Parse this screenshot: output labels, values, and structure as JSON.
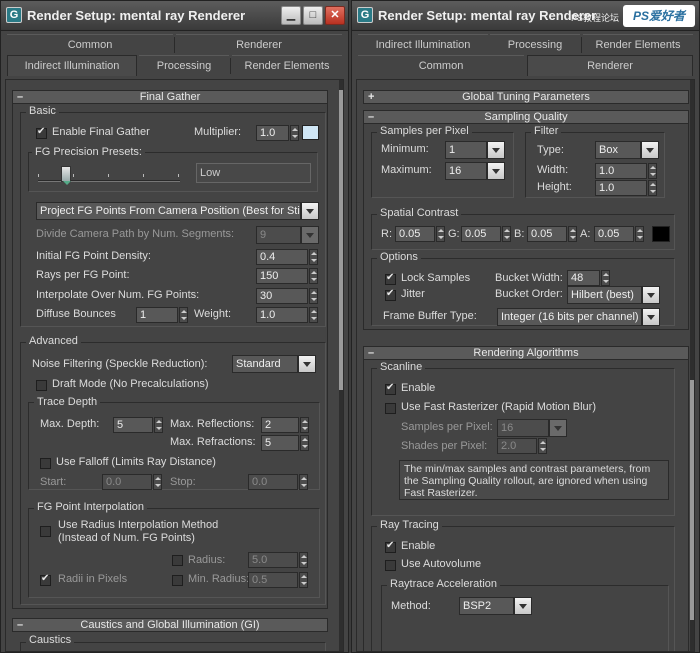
{
  "left": {
    "title": "Render Setup: mental ray Renderer",
    "icon": "G",
    "tabs_row1": [
      "Common",
      "Renderer"
    ],
    "tabs_row2": [
      "Indirect Illumination",
      "Processing",
      "Render Elements"
    ],
    "final_gather": {
      "header": "Final Gather",
      "basic": {
        "label": "Basic",
        "enable_label": "Enable Final Gather",
        "multiplier_label": "Multiplier:",
        "multiplier_value": "1.0",
        "presets_label": "FG Precision Presets:",
        "presets_value": "Low",
        "presets_level": 0.2,
        "project_mode": "Project FG Points From Camera Position (Best for Stills)",
        "divide_label": "Divide Camera Path by Num. Segments:",
        "divide_value": "9",
        "density_label": "Initial FG Point Density:",
        "density_value": "0.4",
        "rays_label": "Rays per FG Point:",
        "rays_value": "150",
        "interp_label": "Interpolate Over Num. FG Points:",
        "interp_value": "30",
        "bounces_label": "Diffuse Bounces",
        "bounces_value": "1",
        "weight_label": "Weight:",
        "weight_value": "1.0"
      },
      "advanced": {
        "label": "Advanced",
        "noise_label": "Noise Filtering (Speckle Reduction):",
        "noise_value": "Standard",
        "draft_label": "Draft Mode (No Precalculations)",
        "trace_depth": {
          "label": "Trace Depth",
          "max_depth_label": "Max. Depth:",
          "max_depth_value": "5",
          "max_refl_label": "Max. Reflections:",
          "max_refl_value": "2",
          "max_refr_label": "Max. Refractions:",
          "max_refr_value": "5",
          "falloff_label": "Use Falloff (Limits Ray Distance)",
          "start_label": "Start:",
          "start_value": "0.0",
          "stop_label": "Stop:",
          "stop_value": "0.0"
        },
        "fg_interp": {
          "label": "FG Point Interpolation",
          "radius_method_line1": "Use Radius Interpolation Method",
          "radius_method_line2": "(Instead of Num. FG Points)",
          "radius_label": "Radius:",
          "radius_value": "5.0",
          "radii_pixels_label": "Radii in Pixels",
          "min_radius_label": "Min. Radius:",
          "min_radius_value": "0.5"
        }
      }
    },
    "caustics": {
      "header": "Caustics and Global Illumination (GI)",
      "sub_label": "Caustics"
    }
  },
  "right": {
    "title": "Render Setup: mental ray Renderer",
    "icon": "G",
    "watermark_text": "PS教程论坛",
    "watermark_logo": "PS爱好者",
    "tabs_row1": [
      "Indirect Illumination",
      "Processing",
      "Render Elements"
    ],
    "tabs_row2": [
      "Common",
      "Renderer"
    ],
    "global_tuning": "Global Tuning Parameters",
    "sampling": {
      "header": "Sampling Quality",
      "samples_label": "Samples per Pixel",
      "min_label": "Minimum:",
      "min_value": "1",
      "max_label": "Maximum:",
      "max_value": "16",
      "filter_label": "Filter",
      "type_label": "Type:",
      "type_value": "Box",
      "width_label": "Width:",
      "width_value": "1.0",
      "height_label": "Height:",
      "height_value": "1.0",
      "contrast_label": "Spatial Contrast",
      "r_label": "R:",
      "r_value": "0.05",
      "g_label": "G:",
      "g_value": "0.05",
      "b_label": "B:",
      "b_value": "0.05",
      "a_label": "A:",
      "a_value": "0.05",
      "options_label": "Options",
      "lock_label": "Lock Samples",
      "jitter_label": "Jitter",
      "bucket_width_label": "Bucket Width:",
      "bucket_width_value": "48",
      "bucket_order_label": "Bucket Order:",
      "bucket_order_value": "Hilbert (best)",
      "fb_label": "Frame Buffer Type:",
      "fb_value": "Integer (16 bits per channel)"
    },
    "rendering": {
      "header": "Rendering Algorithms",
      "scanline_label": "Scanline",
      "enable_label": "Enable",
      "fast_label": "Use Fast Rasterizer (Rapid Motion Blur)",
      "spp_label": "Samples per Pixel:",
      "spp_value": "16",
      "shades_label": "Shades per Pixel:",
      "shades_value": "2.0",
      "note_line1": "The min/max samples and contrast parameters, from",
      "note_line2": "the Sampling Quality rollout, are ignored when using",
      "note_line3": "Fast Rasterizer.",
      "raytrace_label": "Ray Tracing",
      "rt_enable_label": "Enable",
      "autovolume_label": "Use Autovolume",
      "accel_label": "Raytrace Acceleration",
      "method_label": "Method:",
      "method_value": "BSP2"
    }
  },
  "colors": {
    "multiplier_swatch": "#cfe6f5",
    "contrast_swatch": "#000000"
  }
}
